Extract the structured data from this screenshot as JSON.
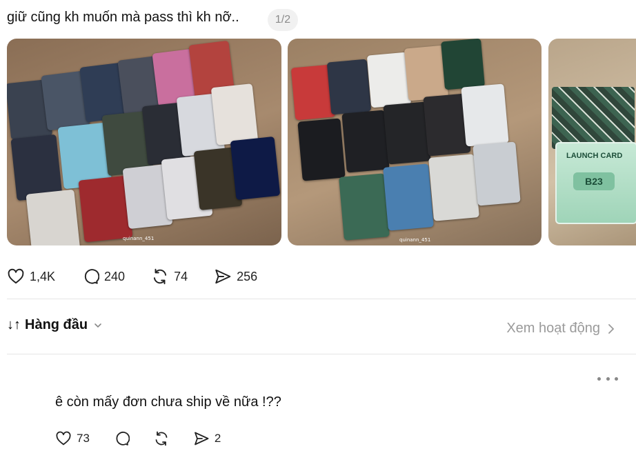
{
  "post": {
    "caption": "giữ cũng kh muốn mà pass thì kh nỡ..",
    "image_counter": "1/2",
    "watermarks": [
      "quinann_451",
      "quinann_451"
    ],
    "badge": {
      "title": "LAUNCH CARD",
      "code": "B23"
    },
    "actions": {
      "likes": "1,4K",
      "comments": "240",
      "reposts": "74",
      "shares": "256"
    }
  },
  "sort": {
    "icon": "↓↑",
    "label": "Hàng đầu",
    "view_activity": "Xem hoạt động"
  },
  "reply": {
    "text": "ê còn mấy đơn chưa ship về nữa !??",
    "actions": {
      "likes": "73",
      "comments": "",
      "reposts": "",
      "shares": "2"
    }
  },
  "icons": [
    "heart-icon",
    "comment-icon",
    "repost-icon",
    "share-icon",
    "chevron-down-icon",
    "chevron-right-icon",
    "more-icon"
  ],
  "colors": {
    "text": "#111111",
    "muted": "#9a9a9a",
    "divider": "#e5e5e5",
    "chip_bg": "#f1f1f1"
  }
}
